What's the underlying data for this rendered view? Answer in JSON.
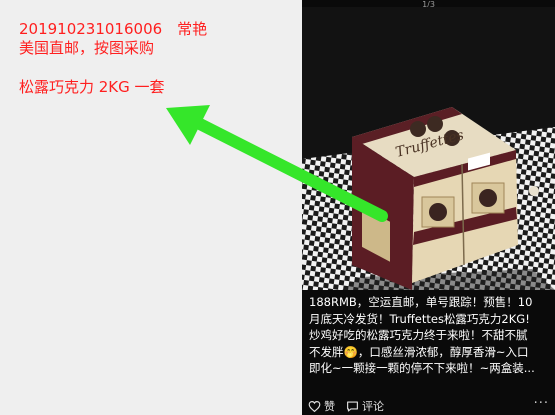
{
  "annotation": {
    "order_line": "201910231016006　常艳",
    "shipping_line": "美国直邮，按图采购",
    "product_line": "松露巧克力 2KG 一套",
    "color": "#ff1f1f"
  },
  "viewer": {
    "page_counter": "1/3",
    "caption_lines": [
      "188RMB，空运直邮，单号跟踪！预售！10",
      "月底天冷发货！Truffettes松露巧克力2KG!",
      "炒鸡好吃的松露巧克力终于来啦！不甜不腻",
      "不发胖🤭，口感丝滑浓郁，醇厚香滑~入口",
      "即化~一颗接一颗的停不下来啦！~两盒装..."
    ],
    "actions": {
      "like_label": "赞",
      "comment_label": "评论",
      "more_label": "···"
    },
    "product_brand": "Truffettes"
  },
  "arrow": {
    "color": "#35e62a"
  }
}
